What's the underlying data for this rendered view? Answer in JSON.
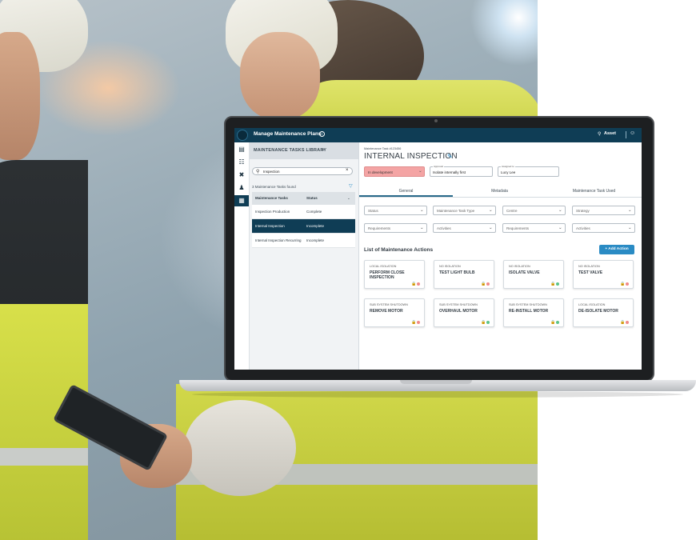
{
  "colors": {
    "topbar": "#0f3d55",
    "accent": "#2a8bc4",
    "status_pink": "#f4a4a4",
    "dot_red": "#f08a8a",
    "dot_green": "#5cc48a"
  },
  "app": {
    "title": "Manage Maintenance Plans",
    "info_icon": "info-icon",
    "asset_label": "Asset",
    "asset_icon": "location-pin-icon",
    "user_icon": "user-icon"
  },
  "rail": {
    "items": [
      {
        "icon": "library-icon",
        "active": false
      },
      {
        "icon": "hierarchy-icon",
        "active": false
      },
      {
        "icon": "tools-icon",
        "active": false
      },
      {
        "icon": "worker-icon",
        "active": false
      },
      {
        "icon": "clipboard-icon",
        "active": true
      }
    ]
  },
  "library": {
    "title": "MAINTENANCE TASKS LIBRARY",
    "search_value": "Inspection",
    "found_text": "3 Maintenance Tasks found",
    "columns": [
      "Maintenance Tasks",
      "Status"
    ],
    "rows": [
      {
        "task": "Inspection Production",
        "status": "Complete",
        "selected": false
      },
      {
        "task": "Internal Inspection",
        "status": "Incomplete",
        "selected": true
      },
      {
        "task": "Internal Inspection Recurring",
        "status": "Incomplete",
        "selected": false
      }
    ]
  },
  "task": {
    "number": "Maintenance Task #123456",
    "title": "INTERNAL INSPECTION",
    "status_value": "In development",
    "approval_label": "Approval",
    "approval_value": "Isolate internally first",
    "assigned_label": "Assigned to",
    "assigned_value": "Lucy Lee"
  },
  "tabs": [
    "General",
    "Metadata",
    "Maintenance Task Used"
  ],
  "filters": {
    "row1": [
      "Status",
      "Maintenance Task Type",
      "Centre",
      "Strategy"
    ],
    "row2": [
      "Requirements",
      "Activities",
      "Requirements",
      "Activities"
    ]
  },
  "actions": {
    "section_title": "List of Maintenance Actions",
    "add_label": "Add Action",
    "cards": [
      {
        "type": "LOCAL ISOLATION",
        "title": "PERFORM CLOSE INSPECTION",
        "status": "red"
      },
      {
        "type": "NO ISOLATION",
        "title": "TEST LIGHT BULB",
        "status": "red"
      },
      {
        "type": "NO ISOLATION",
        "title": "ISOLATE VALVE",
        "status": "green"
      },
      {
        "type": "NO ISOLATION",
        "title": "TEST VALVE",
        "status": "red"
      },
      {
        "type": "SUB SYSTEM SHUTDOWN",
        "title": "REMOVE MOTOR",
        "status": "red"
      },
      {
        "type": "SUB SYSTEM SHUTDOWN",
        "title": "OVERHAUL MOTOR",
        "status": "green"
      },
      {
        "type": "SUB SYSTEM SHUTDOWN",
        "title": "RE-INSTALL MOTOR",
        "status": "green"
      },
      {
        "type": "LOCAL ISOLATION",
        "title": "DE-ISOLATE MOTOR",
        "status": "red"
      }
    ]
  }
}
